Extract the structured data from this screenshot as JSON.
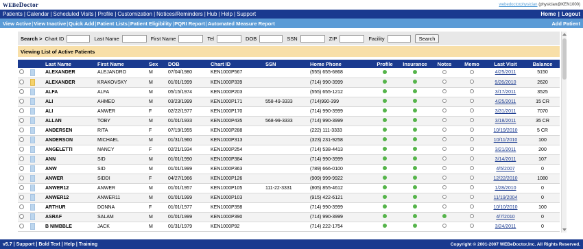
{
  "header": {
    "logo_prefix": "WEB",
    "logo_suffix": "eDoctor",
    "user_link": "webedoctorphysician",
    "user_context": "(physician@KEN1000)"
  },
  "mainnav": {
    "items": [
      "Patients",
      "Calendar",
      "Scheduled Visits",
      "Profile",
      "Customization",
      "Notices/Reminders",
      "Hub",
      "Help",
      "Support"
    ],
    "home": "Home",
    "logout": "Logout"
  },
  "subnav": {
    "items": [
      "View Active",
      "View Inactive",
      "Quick Add",
      "Patient Lists",
      "Patient Eligibility",
      "PQRI Report",
      "Automated Measure Report"
    ],
    "add_patient": "Add Patient"
  },
  "search": {
    "label": "Search >",
    "fields": [
      {
        "label": "Chart ID",
        "value": ""
      },
      {
        "label": "Last Name",
        "value": ""
      },
      {
        "label": "First Name",
        "value": ""
      },
      {
        "label": "Tel",
        "value": ""
      },
      {
        "label": "DOB",
        "value": ""
      },
      {
        "label": "SSN",
        "value": ""
      },
      {
        "label": "ZIP",
        "value": ""
      },
      {
        "label": "Facility",
        "value": ""
      }
    ],
    "button": "Search"
  },
  "viewing_title": "Viewing List of Active Patients",
  "table": {
    "columns": [
      "",
      "",
      "Last Name",
      "First Name",
      "Sex",
      "DOB",
      "Chart ID",
      "SSN",
      "Home Phone",
      "Profile",
      "Insurance",
      "Notes",
      "Memo",
      "Last Visit",
      "Balance"
    ],
    "rows": [
      {
        "flag": "blue",
        "last": "ALEXANDER",
        "first": "ALEJANDRO",
        "sex": "M",
        "dob": "07/04/1980",
        "chart": "KEN1000P567",
        "ssn": "",
        "phone": "(555) 655-6868",
        "profile": "green",
        "insurance": "green",
        "notes": "white",
        "memo": "white",
        "last_visit": "4/25/2011",
        "balance": "5150"
      },
      {
        "flag": "yellow",
        "last": "ALEXANDER",
        "first": "KRAKOVSKY",
        "sex": "M",
        "dob": "01/01/1999",
        "chart": "KEN1000P339",
        "ssn": "",
        "phone": "(714) 990-3999",
        "profile": "green",
        "insurance": "green",
        "notes": "white",
        "memo": "white",
        "last_visit": "9/26/2010",
        "balance": "2620"
      },
      {
        "flag": "blue",
        "last": "ALFA",
        "first": "ALFA",
        "sex": "M",
        "dob": "05/15/1974",
        "chart": "KEN1000P203",
        "ssn": "",
        "phone": "(555) 655-1212",
        "profile": "green",
        "insurance": "green",
        "notes": "white",
        "memo": "white",
        "last_visit": "3/17/2011",
        "balance": "3525"
      },
      {
        "flag": "blue",
        "last": "ALI",
        "first": "AHMED",
        "sex": "M",
        "dob": "03/23/1999",
        "chart": "KEN1000P171",
        "ssn": "558-49-3333",
        "phone": "(714)990-399",
        "profile": "green",
        "insurance": "green",
        "notes": "white",
        "memo": "white",
        "last_visit": "4/25/2011",
        "balance": "15 CR"
      },
      {
        "flag": "blue",
        "last": "ALI",
        "first": "ANWER",
        "sex": "F",
        "dob": "02/22/1977",
        "chart": "KEN1000P170",
        "ssn": "",
        "phone": "(714) 990-3999",
        "profile": "green",
        "insurance": "green",
        "notes": "white",
        "memo": "white",
        "last_visit": "3/31/2011",
        "balance": "7070"
      },
      {
        "flag": "blue",
        "last": "ALLAN",
        "first": "TOBY",
        "sex": "M",
        "dob": "01/01/1933",
        "chart": "KEN1000P435",
        "ssn": "568-99-3333",
        "phone": "(714) 990-3999",
        "profile": "green",
        "insurance": "green",
        "notes": "white",
        "memo": "white",
        "last_visit": "3/18/2011",
        "balance": "35 CR"
      },
      {
        "flag": "blue",
        "last": "ANDERSEN",
        "first": "RITA",
        "sex": "F",
        "dob": "07/19/1955",
        "chart": "KEN1000P288",
        "ssn": "",
        "phone": "(222) 111-3333",
        "profile": "green",
        "insurance": "green",
        "notes": "white",
        "memo": "white",
        "last_visit": "10/19/2010",
        "balance": "5 CR"
      },
      {
        "flag": "blue",
        "last": "ANDERSON",
        "first": "MICHAEL",
        "sex": "M",
        "dob": "01/31/1960",
        "chart": "KEN1000P313",
        "ssn": "",
        "phone": "(323) 231-9258",
        "profile": "green",
        "insurance": "green",
        "notes": "white",
        "memo": "white",
        "last_visit": "10/11/2010",
        "balance": "100"
      },
      {
        "flag": "blue",
        "last": "ANGELETTI",
        "first": "NANCY",
        "sex": "F",
        "dob": "02/21/1934",
        "chart": "KEN1000P254",
        "ssn": "",
        "phone": "(714) 538-4413",
        "profile": "green",
        "insurance": "green",
        "notes": "white",
        "memo": "white",
        "last_visit": "3/21/2011",
        "balance": "200"
      },
      {
        "flag": "blue",
        "last": "ANN",
        "first": "SID",
        "sex": "M",
        "dob": "01/01/1990",
        "chart": "KEN1000P384",
        "ssn": "",
        "phone": "(714) 990-3999",
        "profile": "green",
        "insurance": "green",
        "notes": "white",
        "memo": "white",
        "last_visit": "3/14/2011",
        "balance": "107"
      },
      {
        "flag": "blue",
        "last": "ANW",
        "first": "SID",
        "sex": "M",
        "dob": "01/01/1999",
        "chart": "KEN1000P363",
        "ssn": "",
        "phone": "(789) 666-0100",
        "profile": "green",
        "insurance": "green",
        "notes": "white",
        "memo": "white",
        "last_visit": "4/5/2007",
        "balance": "0"
      },
      {
        "flag": "blue",
        "last": "ANWER",
        "first": "SIDDI",
        "sex": "F",
        "dob": "04/27/1966",
        "chart": "KEN1000P126",
        "ssn": "",
        "phone": "(909) 999-9922",
        "profile": "green",
        "insurance": "green",
        "notes": "white",
        "memo": "white",
        "last_visit": "12/22/2010",
        "balance": "1080"
      },
      {
        "flag": "blue",
        "last": "ANWER12",
        "first": "ANWER",
        "sex": "M",
        "dob": "01/01/1957",
        "chart": "KEN1000P105",
        "ssn": "111-22-3331",
        "phone": "(805) 855-4612",
        "profile": "green",
        "insurance": "green",
        "notes": "white",
        "memo": "white",
        "last_visit": "1/28/2010",
        "balance": "0"
      },
      {
        "flag": "blue",
        "last": "ANWER12",
        "first": "ANWER11",
        "sex": "M",
        "dob": "01/01/1999",
        "chart": "KEN1000P103",
        "ssn": "",
        "phone": "(915) 422-6121",
        "profile": "green",
        "insurance": "green",
        "notes": "white",
        "memo": "white",
        "last_visit": "11/19/2004",
        "balance": "0"
      },
      {
        "flag": "blue",
        "last": "ARTHUR",
        "first": "DONNA",
        "sex": "F",
        "dob": "01/01/1977",
        "chart": "KEN1000P398",
        "ssn": "",
        "phone": "(714) 990-3999",
        "profile": "green",
        "insurance": "green",
        "notes": "white",
        "memo": "white",
        "last_visit": "10/10/2010",
        "balance": "100"
      },
      {
        "flag": "blue",
        "last": "ASRAF",
        "first": "SALAM",
        "sex": "M",
        "dob": "01/01/1999",
        "chart": "KEN1000P390",
        "ssn": "",
        "phone": "(714) 990-3999",
        "profile": "green",
        "insurance": "green",
        "notes": "green",
        "memo": "white",
        "last_visit": "4/7/2010",
        "balance": "0"
      },
      {
        "flag": "blue",
        "last": "B NIMBBLE",
        "first": "JACK",
        "sex": "M",
        "dob": "01/31/1979",
        "chart": "KEN1000P92",
        "ssn": "",
        "phone": "(714) 222-1754",
        "profile": "green",
        "insurance": "green",
        "notes": "white",
        "memo": "white",
        "last_visit": "3/24/2011",
        "balance": "0"
      }
    ]
  },
  "footer": {
    "items": [
      "v5.7",
      "Support",
      "Bold Text",
      "Help",
      "Training"
    ],
    "copyright": "Copyright © 2001-2007 WEBeDoctor,Inc. All Rights Reserved."
  },
  "colors": {
    "nav_dark": "#1a3a8f",
    "nav_light": "#5b9bd6",
    "viewing_bg": "#f8dfa8",
    "status_green": "#55b44a"
  }
}
